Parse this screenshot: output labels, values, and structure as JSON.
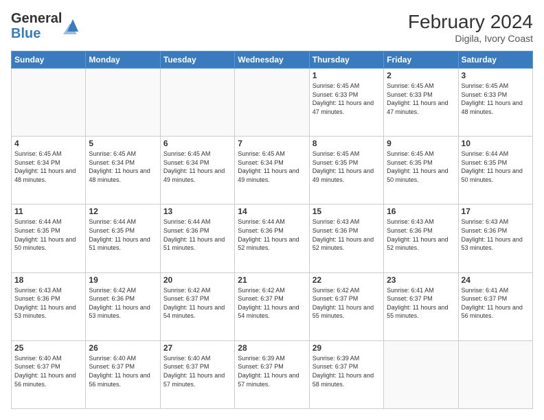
{
  "header": {
    "logo_general": "General",
    "logo_blue": "Blue",
    "month_year": "February 2024",
    "location": "Digila, Ivory Coast"
  },
  "days_of_week": [
    "Sunday",
    "Monday",
    "Tuesday",
    "Wednesday",
    "Thursday",
    "Friday",
    "Saturday"
  ],
  "weeks": [
    [
      {
        "day": "",
        "empty": true
      },
      {
        "day": "",
        "empty": true
      },
      {
        "day": "",
        "empty": true
      },
      {
        "day": "",
        "empty": true
      },
      {
        "day": "1",
        "sunrise": "6:45 AM",
        "sunset": "6:33 PM",
        "daylight": "11 hours and 47 minutes."
      },
      {
        "day": "2",
        "sunrise": "6:45 AM",
        "sunset": "6:33 PM",
        "daylight": "11 hours and 47 minutes."
      },
      {
        "day": "3",
        "sunrise": "6:45 AM",
        "sunset": "6:33 PM",
        "daylight": "11 hours and 48 minutes."
      }
    ],
    [
      {
        "day": "4",
        "sunrise": "6:45 AM",
        "sunset": "6:34 PM",
        "daylight": "11 hours and 48 minutes."
      },
      {
        "day": "5",
        "sunrise": "6:45 AM",
        "sunset": "6:34 PM",
        "daylight": "11 hours and 48 minutes."
      },
      {
        "day": "6",
        "sunrise": "6:45 AM",
        "sunset": "6:34 PM",
        "daylight": "11 hours and 49 minutes."
      },
      {
        "day": "7",
        "sunrise": "6:45 AM",
        "sunset": "6:34 PM",
        "daylight": "11 hours and 49 minutes."
      },
      {
        "day": "8",
        "sunrise": "6:45 AM",
        "sunset": "6:35 PM",
        "daylight": "11 hours and 49 minutes."
      },
      {
        "day": "9",
        "sunrise": "6:45 AM",
        "sunset": "6:35 PM",
        "daylight": "11 hours and 50 minutes."
      },
      {
        "day": "10",
        "sunrise": "6:44 AM",
        "sunset": "6:35 PM",
        "daylight": "11 hours and 50 minutes."
      }
    ],
    [
      {
        "day": "11",
        "sunrise": "6:44 AM",
        "sunset": "6:35 PM",
        "daylight": "11 hours and 50 minutes."
      },
      {
        "day": "12",
        "sunrise": "6:44 AM",
        "sunset": "6:35 PM",
        "daylight": "11 hours and 51 minutes."
      },
      {
        "day": "13",
        "sunrise": "6:44 AM",
        "sunset": "6:36 PM",
        "daylight": "11 hours and 51 minutes."
      },
      {
        "day": "14",
        "sunrise": "6:44 AM",
        "sunset": "6:36 PM",
        "daylight": "11 hours and 52 minutes."
      },
      {
        "day": "15",
        "sunrise": "6:43 AM",
        "sunset": "6:36 PM",
        "daylight": "11 hours and 52 minutes."
      },
      {
        "day": "16",
        "sunrise": "6:43 AM",
        "sunset": "6:36 PM",
        "daylight": "11 hours and 52 minutes."
      },
      {
        "day": "17",
        "sunrise": "6:43 AM",
        "sunset": "6:36 PM",
        "daylight": "11 hours and 53 minutes."
      }
    ],
    [
      {
        "day": "18",
        "sunrise": "6:43 AM",
        "sunset": "6:36 PM",
        "daylight": "11 hours and 53 minutes."
      },
      {
        "day": "19",
        "sunrise": "6:42 AM",
        "sunset": "6:36 PM",
        "daylight": "11 hours and 53 minutes."
      },
      {
        "day": "20",
        "sunrise": "6:42 AM",
        "sunset": "6:37 PM",
        "daylight": "11 hours and 54 minutes."
      },
      {
        "day": "21",
        "sunrise": "6:42 AM",
        "sunset": "6:37 PM",
        "daylight": "11 hours and 54 minutes."
      },
      {
        "day": "22",
        "sunrise": "6:42 AM",
        "sunset": "6:37 PM",
        "daylight": "11 hours and 55 minutes."
      },
      {
        "day": "23",
        "sunrise": "6:41 AM",
        "sunset": "6:37 PM",
        "daylight": "11 hours and 55 minutes."
      },
      {
        "day": "24",
        "sunrise": "6:41 AM",
        "sunset": "6:37 PM",
        "daylight": "11 hours and 56 minutes."
      }
    ],
    [
      {
        "day": "25",
        "sunrise": "6:40 AM",
        "sunset": "6:37 PM",
        "daylight": "11 hours and 56 minutes."
      },
      {
        "day": "26",
        "sunrise": "6:40 AM",
        "sunset": "6:37 PM",
        "daylight": "11 hours and 56 minutes."
      },
      {
        "day": "27",
        "sunrise": "6:40 AM",
        "sunset": "6:37 PM",
        "daylight": "11 hours and 57 minutes."
      },
      {
        "day": "28",
        "sunrise": "6:39 AM",
        "sunset": "6:37 PM",
        "daylight": "11 hours and 57 minutes."
      },
      {
        "day": "29",
        "sunrise": "6:39 AM",
        "sunset": "6:37 PM",
        "daylight": "11 hours and 58 minutes."
      },
      {
        "day": "",
        "empty": true
      },
      {
        "day": "",
        "empty": true
      }
    ]
  ]
}
